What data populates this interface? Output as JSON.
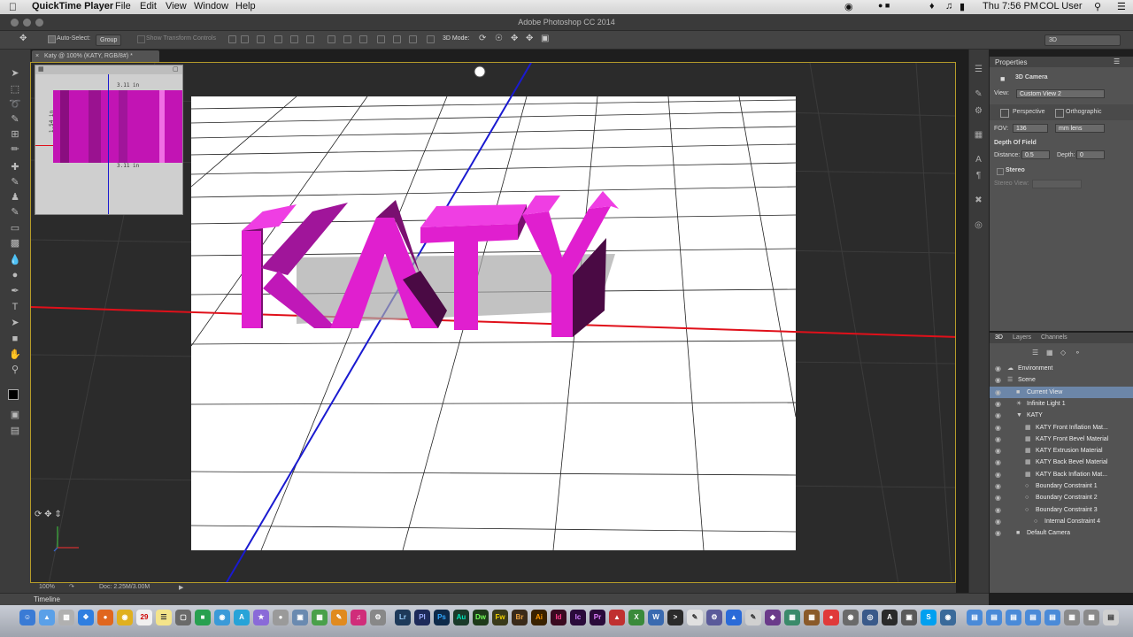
{
  "menubar": {
    "app_name": "QuickTime Player",
    "items": [
      "File",
      "Edit",
      "View",
      "Window",
      "Help"
    ],
    "clock": "Thu 7:56 PM",
    "user": "COL User"
  },
  "window": {
    "title": "Adobe Photoshop CC 2014"
  },
  "options_bar": {
    "auto_select_label": "Auto-Select:",
    "auto_select_value": "Group",
    "show_transform_controls": "Show Transform Controls",
    "mode_3d_label": "3D Mode:",
    "workspace": "3D"
  },
  "document": {
    "tab_title": "Katy @ 100% (KATY, RGB/8#) *",
    "zoom": "100%",
    "doc_info": "Doc: 2.25M/3.00M",
    "text_3d": "KATY",
    "ruler_width": "3.11 in",
    "ruler_height": "1.54 in"
  },
  "timeline": {
    "label": "Timeline"
  },
  "properties": {
    "header": "Properties",
    "section": "3D Camera",
    "view_label": "View:",
    "view_value": "Custom View 2",
    "perspective": "Perspective",
    "orthographic": "Orthographic",
    "fov_label": "FOV:",
    "fov_value": "136",
    "lens_value": "mm lens",
    "dof_label": "Depth Of Field",
    "distance_label": "Distance:",
    "distance_value": "0.5",
    "depth_label": "Depth:",
    "depth_value": "0",
    "stereo_label": "Stereo",
    "stereo_view_label": "Stereo View:"
  },
  "panel3d": {
    "tabs": [
      "3D",
      "Layers",
      "Channels"
    ],
    "items": [
      {
        "label": "Environment",
        "indent": 0
      },
      {
        "label": "Scene",
        "indent": 0
      },
      {
        "label": "Current View",
        "indent": 1,
        "selected": true
      },
      {
        "label": "Infinite Light 1",
        "indent": 1
      },
      {
        "label": "KATY",
        "indent": 1
      },
      {
        "label": "KATY Front Inflation Mat...",
        "indent": 2
      },
      {
        "label": "KATY Front Bevel Material",
        "indent": 2
      },
      {
        "label": "KATY Extrusion Material",
        "indent": 2
      },
      {
        "label": "KATY Back Bevel Material",
        "indent": 2
      },
      {
        "label": "KATY Back Inflation Mat...",
        "indent": 2
      },
      {
        "label": "Boundary Constraint 1",
        "indent": 2
      },
      {
        "label": "Boundary Constraint 2",
        "indent": 2
      },
      {
        "label": "Boundary Constraint 3",
        "indent": 2
      },
      {
        "label": "Internal Constraint 4",
        "indent": 3
      },
      {
        "label": "Default Camera",
        "indent": 1
      }
    ]
  },
  "dock": {
    "apps": [
      "Lr",
      "Pl",
      "Ps",
      "Au",
      "Dw",
      "Fw",
      "Br",
      "Ai",
      "Id",
      "Ic",
      "Pr",
      "X",
      "A",
      "S"
    ]
  },
  "colors": {
    "magenta": "#e01fcf",
    "accent_selected": "#6c86a8"
  }
}
